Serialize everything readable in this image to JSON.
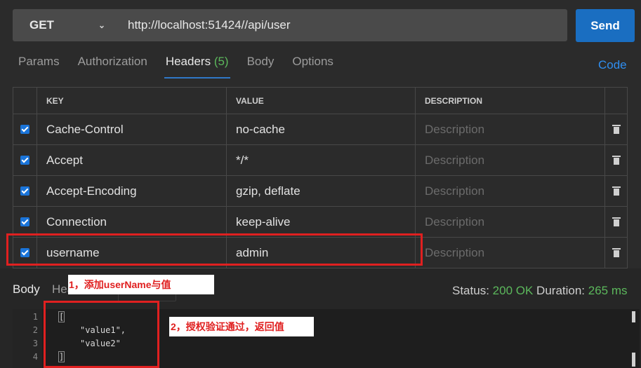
{
  "request": {
    "method": "GET",
    "url": "http://localhost:51424//api/user",
    "send_label": "Send"
  },
  "tabs": [
    {
      "label": "Params"
    },
    {
      "label": "Authorization"
    },
    {
      "label": "Headers",
      "count": "(5)",
      "active": true
    },
    {
      "label": "Body"
    },
    {
      "label": "Options"
    }
  ],
  "code_link": "Code",
  "headers_table": {
    "columns": [
      "KEY",
      "VALUE",
      "DESCRIPTION"
    ],
    "rows": [
      {
        "key": "Cache-Control",
        "value": "no-cache",
        "description_placeholder": "Description",
        "checked": true
      },
      {
        "key": "Accept",
        "value": "*/*",
        "description_placeholder": "Description",
        "checked": true
      },
      {
        "key": "Accept-Encoding",
        "value": "gzip, deflate",
        "description_placeholder": "Description",
        "checked": true
      },
      {
        "key": "Connection",
        "value": "keep-alive",
        "description_placeholder": "Description",
        "checked": true
      },
      {
        "key": "username",
        "value": "admin",
        "description_placeholder": "Description",
        "checked": true
      }
    ]
  },
  "response": {
    "body_tab": "Body",
    "headers_tab": "Headers",
    "status_label": "Status:",
    "status_value": "200 OK",
    "duration_label": "Duration:",
    "duration_value": "265 ms",
    "lines": [
      "1",
      "2",
      "3",
      "4"
    ],
    "code": [
      "[",
      "\"value1\",",
      "\"value2\"",
      "]"
    ]
  },
  "annotations": {
    "note1": "1，添加userName与值",
    "note2": "2，授权验证通过，返回值"
  },
  "colors": {
    "accent": "#1a6ec1",
    "success": "#5cb85c",
    "annotation": "#e02020"
  }
}
